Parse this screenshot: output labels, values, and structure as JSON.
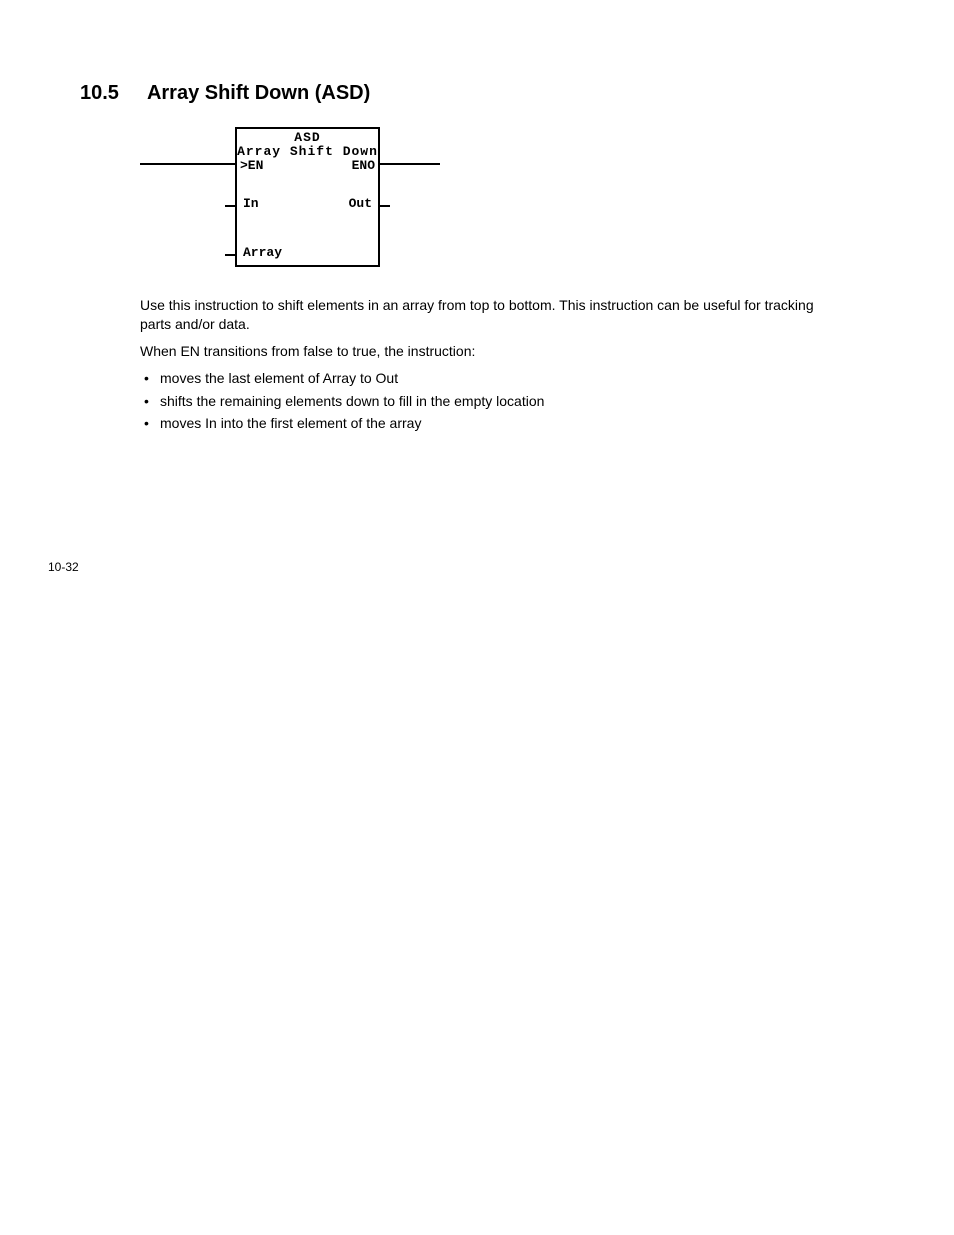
{
  "heading": {
    "number": "10.5",
    "title": "Array Shift Down (ASD)"
  },
  "diagram": {
    "code": "ASD",
    "name": "Array Shift Down",
    "en": ">EN",
    "eno": "ENO",
    "in": "In",
    "out": "Out",
    "array": "Array"
  },
  "paragraphs": {
    "p1": "Use this instruction to shift elements in an array from top to bottom. This instruction can be useful for tracking parts and/or data.",
    "p2": "When EN transitions from false to true, the instruction:"
  },
  "bullets": [
    "moves the last element of Array to Out",
    "shifts the remaining elements down to fill in the empty location",
    "moves In into the first element of the array"
  ],
  "pageNumber": "10-32"
}
